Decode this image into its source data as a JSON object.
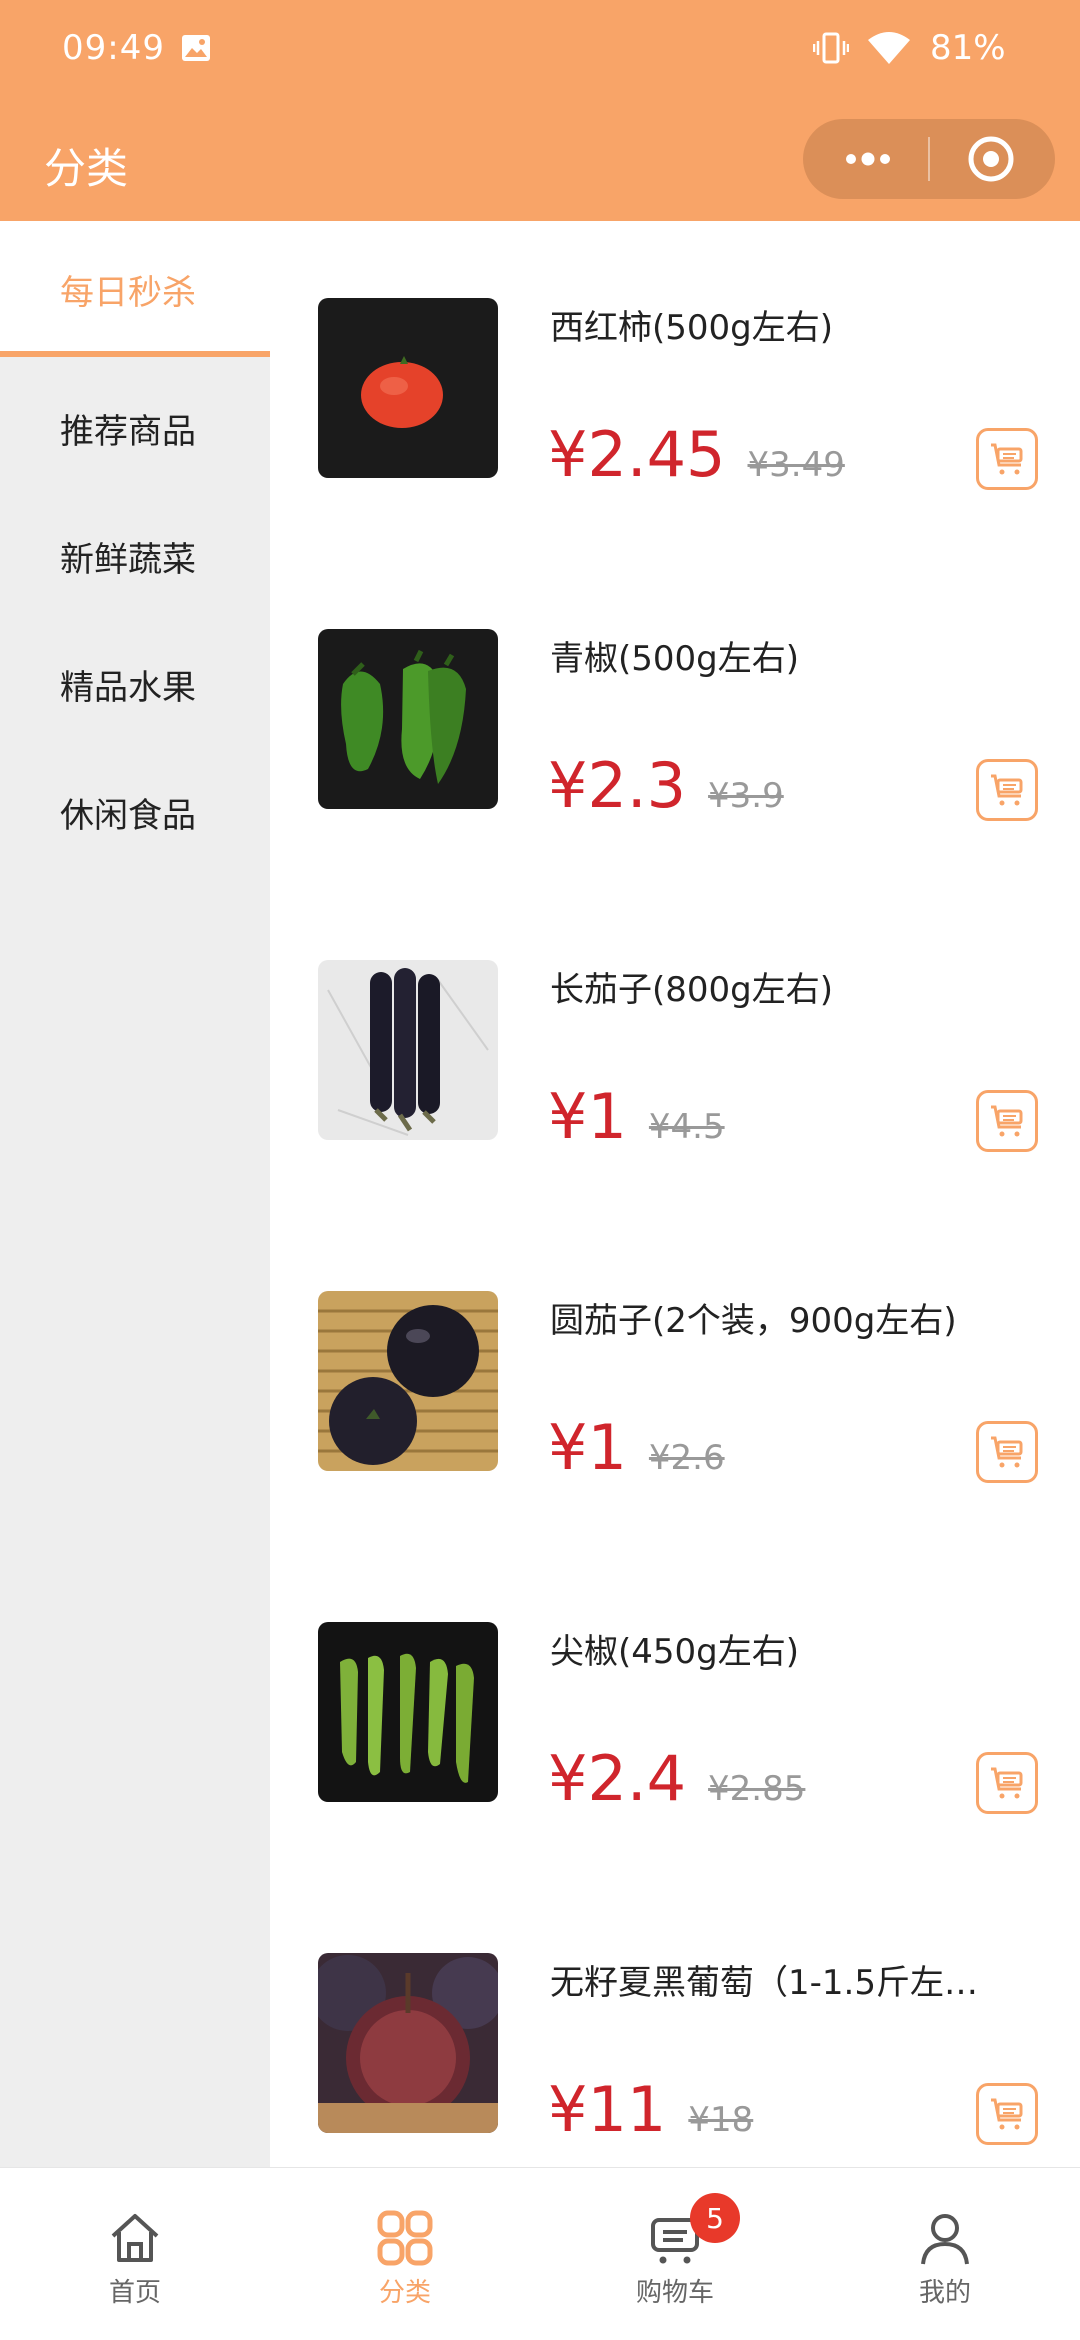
{
  "status_bar": {
    "time": "09:49",
    "battery": "81%",
    "icons": [
      "gallery-icon",
      "vibrate-icon",
      "wifi-icon"
    ]
  },
  "nav": {
    "title": "分类",
    "capsule_icons": [
      "more-icon",
      "target-icon"
    ]
  },
  "colors": {
    "brand": "#f8a468",
    "price": "#d0252c",
    "badge": "#e8392a",
    "sidebar_bg": "#eeeeee"
  },
  "sidebar": {
    "items": [
      {
        "label": "每日秒杀",
        "active": true
      },
      {
        "label": "推荐商品",
        "active": false
      },
      {
        "label": "新鲜蔬菜",
        "active": false
      },
      {
        "label": "精品水果",
        "active": false
      },
      {
        "label": "休闲食品",
        "active": false
      }
    ]
  },
  "products": [
    {
      "name": "西红柿(500g左右)",
      "price": "¥2.45",
      "old_price": "¥3.49",
      "image": "tomato"
    },
    {
      "name": "青椒(500g左右)",
      "price": "¥2.3",
      "old_price": "¥3.9",
      "image": "green-pepper"
    },
    {
      "name": "长茄子(800g左右)",
      "price": "¥1",
      "old_price": "¥4.5",
      "image": "long-eggplant"
    },
    {
      "name": "圆茄子(2个装，900g左右)",
      "price": "¥1",
      "old_price": "¥2.6",
      "image": "round-eggplant"
    },
    {
      "name": "尖椒(450g左右)",
      "price": "¥2.4",
      "old_price": "¥2.85",
      "image": "chili-pepper"
    },
    {
      "name": "无籽夏黑葡萄（1-1.5斤左…",
      "price": "¥11",
      "old_price": "¥18",
      "image": "black-grape"
    }
  ],
  "tabbar": {
    "items": [
      {
        "label": "首页",
        "icon": "home-icon",
        "active": false
      },
      {
        "label": "分类",
        "icon": "category-icon",
        "active": true
      },
      {
        "label": "购物车",
        "icon": "cart-icon",
        "active": false,
        "badge": "5"
      },
      {
        "label": "我的",
        "icon": "user-icon",
        "active": false
      }
    ]
  }
}
